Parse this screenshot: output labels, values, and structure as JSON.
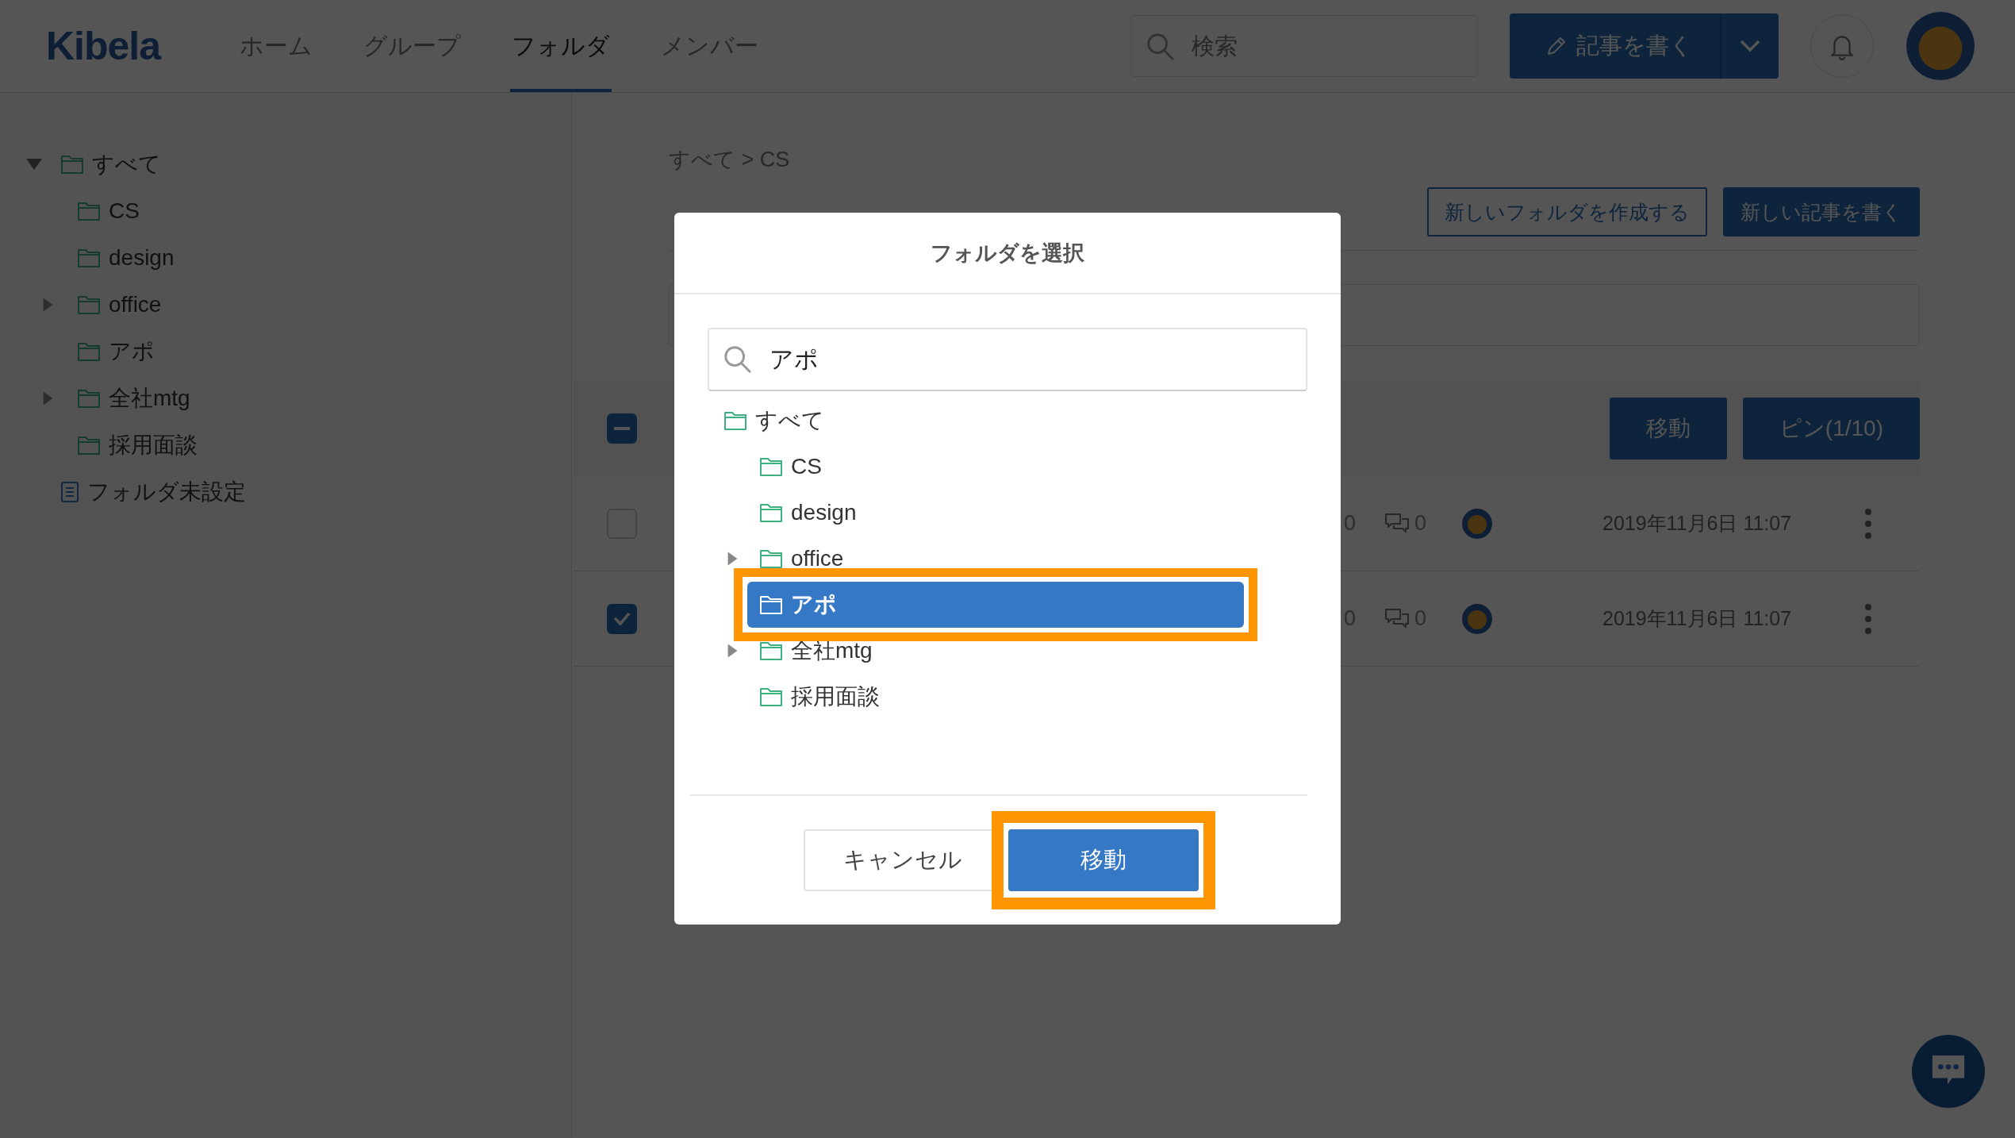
{
  "header": {
    "logo": "Kibela",
    "nav": [
      {
        "label": "ホーム",
        "selected": false
      },
      {
        "label": "グループ",
        "selected": false
      },
      {
        "label": "フォルダ",
        "selected": true
      },
      {
        "label": "メンバー",
        "selected": false
      }
    ],
    "search": {
      "placeholder": "検索"
    },
    "write_button": "記事を書く"
  },
  "sidebar": {
    "tree": [
      {
        "label": "すべて",
        "kind": "folder",
        "has_children": true,
        "expanded": true,
        "children": [
          {
            "label": "CS",
            "kind": "folder",
            "has_children": false
          },
          {
            "label": "design",
            "kind": "folder",
            "has_children": false
          },
          {
            "label": "office",
            "kind": "folder",
            "has_children": true,
            "expanded": false
          },
          {
            "label": "アポ",
            "kind": "folder",
            "has_children": false
          },
          {
            "label": "全社mtg",
            "kind": "folder",
            "has_children": true,
            "expanded": false
          },
          {
            "label": "採用面談",
            "kind": "folder",
            "has_children": false
          }
        ]
      },
      {
        "label": "フォルダ未設定",
        "kind": "unfiled",
        "has_children": false
      }
    ]
  },
  "main": {
    "breadcrumb": "すべて > CS",
    "actions": [
      {
        "label": "新しいフォルダを作成する",
        "kind": "outline"
      },
      {
        "label": "新しい記事を書く",
        "kind": "primary"
      }
    ],
    "toolbar": {
      "select_all": {
        "indeterminate": true
      },
      "buttons": [
        "移動",
        "ピン(1/10)"
      ]
    },
    "rows": [
      {
        "checked": false,
        "likes": "0",
        "comments": "0",
        "date": "2019年11月6日 11:07"
      },
      {
        "checked": true,
        "likes": "0",
        "comments": "0",
        "date": "2019年11月6日 11:07"
      }
    ]
  },
  "dialog": {
    "title": "フォルダを選択",
    "search": {
      "value": "アポ"
    },
    "tree": [
      {
        "label": "すべて",
        "kind": "folder",
        "has_children": false,
        "selected": false,
        "highlighted": false,
        "children": [
          {
            "label": "CS",
            "kind": "folder",
            "has_children": false,
            "selected": false,
            "highlighted": false
          },
          {
            "label": "design",
            "kind": "folder",
            "has_children": false,
            "selected": false,
            "highlighted": false
          },
          {
            "label": "office",
            "kind": "folder",
            "has_children": true,
            "expanded": false,
            "selected": false,
            "highlighted": false
          },
          {
            "label": "アポ",
            "kind": "folder",
            "has_children": false,
            "selected": true,
            "highlighted": true
          },
          {
            "label": "全社mtg",
            "kind": "folder",
            "has_children": true,
            "expanded": false,
            "selected": false,
            "highlighted": false
          },
          {
            "label": "採用面談",
            "kind": "folder",
            "has_children": false,
            "selected": false,
            "highlighted": false
          }
        ]
      }
    ],
    "buttons": [
      {
        "label": "キャンセル",
        "kind": "secondary",
        "highlighted": false
      },
      {
        "label": "移動",
        "kind": "primary",
        "highlighted": true
      }
    ]
  }
}
